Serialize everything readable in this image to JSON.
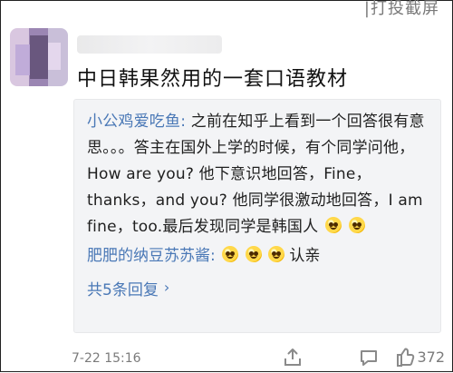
{
  "header": {
    "hint": "|打投截屏"
  },
  "post": {
    "text": "中日韩果然用的一套口语教材"
  },
  "comments": [
    {
      "user": "小公鸡爱吃鱼:",
      "text": "之前在知乎上看到一个回答很有意思。。。答主在国外上学的时候，有个同学问他，How are you? 他下意识地回答，Fine，thanks，and you? 他同学很激动地回答，I am fine，too.最后发现同学是韩国人"
    }
  ],
  "reply": {
    "user": "肥肥的纳豆苏苏酱:",
    "text": "认亲"
  },
  "more": {
    "label": "共5条回复"
  },
  "footer": {
    "time": "7-22 15:16",
    "likes": "372"
  },
  "colors": {
    "name": "#4a78b6",
    "bg": "#ffffff",
    "card_bg": "#f3f4f6",
    "muted": "#7b7b7b"
  }
}
